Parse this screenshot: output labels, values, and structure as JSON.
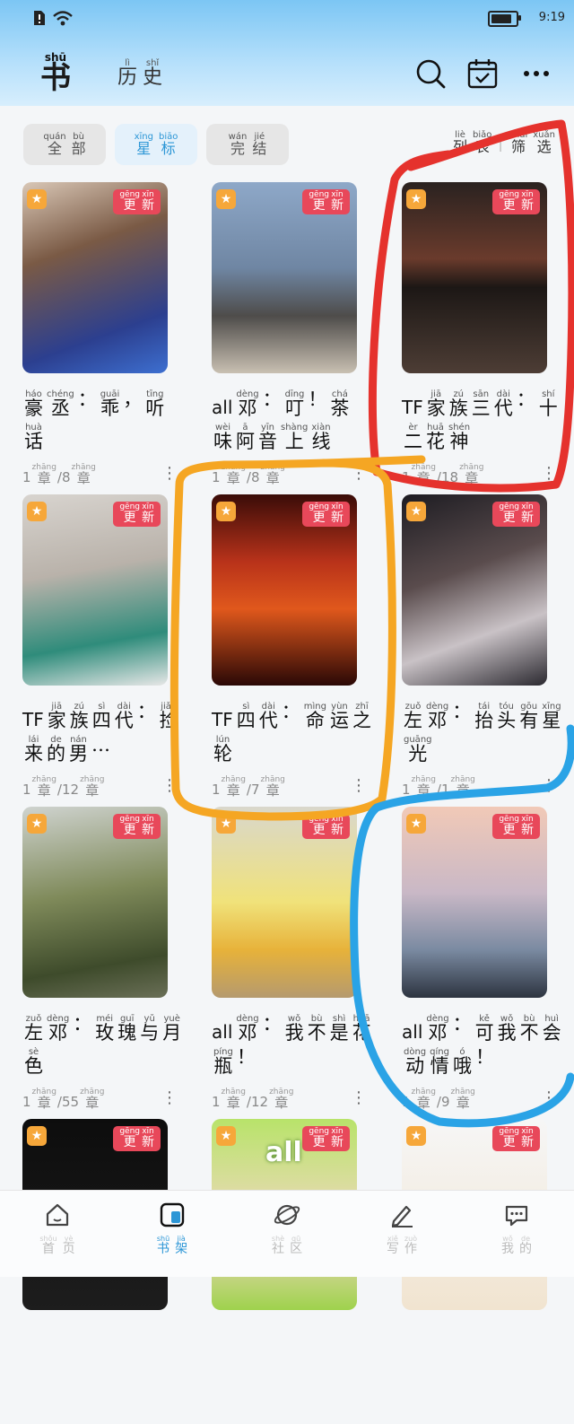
{
  "status": {
    "time": "9:19"
  },
  "header": {
    "logo": {
      "py": "shū",
      "hz": "书"
    },
    "tab_history": [
      {
        "py": "lì",
        "hz": "历"
      },
      {
        "py": "shǐ",
        "hz": "史"
      }
    ],
    "icons": [
      "search-icon",
      "calendar-check-icon",
      "more-icon"
    ]
  },
  "filters": {
    "chips": [
      {
        "chars": [
          {
            "py": "quán",
            "hz": "全"
          },
          {
            "py": "bù",
            "hz": "部"
          }
        ],
        "active": false
      },
      {
        "chars": [
          {
            "py": "xīng",
            "hz": "星"
          },
          {
            "py": "biāo",
            "hz": "标"
          }
        ],
        "active": true
      },
      {
        "chars": [
          {
            "py": "wán",
            "hz": "完"
          },
          {
            "py": "jié",
            "hz": "结"
          }
        ],
        "active": false
      }
    ],
    "list_label": [
      {
        "py": "liè",
        "hz": "列"
      },
      {
        "py": "biǎo",
        "hz": "表"
      }
    ],
    "filter_label": [
      {
        "py": "shāi",
        "hz": "筛"
      },
      {
        "py": "xuǎn",
        "hz": "选"
      }
    ]
  },
  "badge": [
    {
      "py": "gēng",
      "hz": "更"
    },
    {
      "py": "xīn",
      "hz": "新"
    }
  ],
  "books": [
    {
      "prefix": "",
      "title": [
        {
          "py": "háo",
          "hz": "豪"
        },
        {
          "py": "chéng",
          "hz": "丞"
        },
        {
          "py": "",
          "hz": "："
        },
        {
          "py": "guāi",
          "hz": "乖"
        },
        {
          "py": "",
          "hz": "，"
        },
        {
          "py": "tīng",
          "hz": "听"
        },
        {
          "py": "huà",
          "hz": "话"
        }
      ],
      "read": "1",
      "total": "8"
    },
    {
      "prefix": "all",
      "title": [
        {
          "py": "dèng",
          "hz": "邓"
        },
        {
          "py": "",
          "hz": "："
        },
        {
          "py": "dīng",
          "hz": "叮"
        },
        {
          "py": "",
          "hz": "！"
        },
        {
          "py": "chá",
          "hz": "茶"
        },
        {
          "py": "wèi",
          "hz": "味"
        },
        {
          "py": "ā",
          "hz": "阿"
        },
        {
          "py": "yīn",
          "hz": "音"
        },
        {
          "py": "shàng",
          "hz": "上"
        },
        {
          "py": "xiàn",
          "hz": "线"
        }
      ],
      "read": "1",
      "total": "8"
    },
    {
      "prefix": "TF",
      "title": [
        {
          "py": "jiā",
          "hz": "家"
        },
        {
          "py": "zú",
          "hz": "族"
        },
        {
          "py": "sān",
          "hz": "三"
        },
        {
          "py": "dài",
          "hz": "代"
        },
        {
          "py": "",
          "hz": "："
        },
        {
          "py": "shí",
          "hz": "十"
        },
        {
          "py": "èr",
          "hz": "二"
        },
        {
          "py": "huā",
          "hz": "花"
        },
        {
          "py": "shén",
          "hz": "神"
        }
      ],
      "read": "1",
      "total": "18"
    },
    {
      "prefix": "TF",
      "title": [
        {
          "py": "jiā",
          "hz": "家"
        },
        {
          "py": "zú",
          "hz": "族"
        },
        {
          "py": "sì",
          "hz": "四"
        },
        {
          "py": "dài",
          "hz": "代"
        },
        {
          "py": "",
          "hz": "："
        },
        {
          "py": "jiǎn",
          "hz": "捡"
        },
        {
          "py": "lái",
          "hz": "来"
        },
        {
          "py": "de",
          "hz": "的"
        },
        {
          "py": "nán",
          "hz": "男"
        },
        {
          "py": "",
          "hz": "…"
        }
      ],
      "read": "1",
      "total": "12"
    },
    {
      "prefix": "TF",
      "title": [
        {
          "py": "sì",
          "hz": "四"
        },
        {
          "py": "dài",
          "hz": "代"
        },
        {
          "py": "",
          "hz": "："
        },
        {
          "py": "mìng",
          "hz": "命"
        },
        {
          "py": "yùn",
          "hz": "运"
        },
        {
          "py": "zhī",
          "hz": "之"
        },
        {
          "py": "lún",
          "hz": "轮"
        }
      ],
      "read": "1",
      "total": "7"
    },
    {
      "prefix": "",
      "title": [
        {
          "py": "zuǒ",
          "hz": "左"
        },
        {
          "py": "dèng",
          "hz": "邓"
        },
        {
          "py": "",
          "hz": "："
        },
        {
          "py": "tái",
          "hz": "抬"
        },
        {
          "py": "tóu",
          "hz": "头"
        },
        {
          "py": "gōu",
          "hz": "有"
        },
        {
          "py": "xīng",
          "hz": "星"
        },
        {
          "py": "guāng",
          "hz": "光"
        }
      ],
      "read": "1",
      "total": "1"
    },
    {
      "prefix": "",
      "title": [
        {
          "py": "zuǒ",
          "hz": "左"
        },
        {
          "py": "dèng",
          "hz": "邓"
        },
        {
          "py": "",
          "hz": "："
        },
        {
          "py": "méi",
          "hz": "玫"
        },
        {
          "py": "guī",
          "hz": "瑰"
        },
        {
          "py": "yǔ",
          "hz": "与"
        },
        {
          "py": "yuè",
          "hz": "月"
        },
        {
          "py": "sè",
          "hz": "色"
        }
      ],
      "read": "1",
      "total": "55"
    },
    {
      "prefix": "all",
      "title": [
        {
          "py": "dèng",
          "hz": "邓"
        },
        {
          "py": "",
          "hz": "："
        },
        {
          "py": "wǒ",
          "hz": "我"
        },
        {
          "py": "bù",
          "hz": "不"
        },
        {
          "py": "shì",
          "hz": "是"
        },
        {
          "py": "huā",
          "hz": "花"
        },
        {
          "py": "píng",
          "hz": "瓶"
        },
        {
          "py": "",
          "hz": "！"
        }
      ],
      "read": "1",
      "total": "12"
    },
    {
      "prefix": "all",
      "title": [
        {
          "py": "dèng",
          "hz": "邓"
        },
        {
          "py": "",
          "hz": "："
        },
        {
          "py": "kě",
          "hz": "可"
        },
        {
          "py": "wǒ",
          "hz": "我"
        },
        {
          "py": "bù",
          "hz": "不"
        },
        {
          "py": "huì",
          "hz": "会"
        },
        {
          "py": "dòng",
          "hz": "动"
        },
        {
          "py": "qíng",
          "hz": "情"
        },
        {
          "py": "ó",
          "hz": "哦"
        },
        {
          "py": "",
          "hz": "！"
        }
      ],
      "read": "1",
      "total": "9"
    },
    {
      "prefix": "",
      "title": [],
      "read": "",
      "total": ""
    },
    {
      "prefix": "",
      "title": [],
      "read": "",
      "total": "",
      "cover_text": "all"
    },
    {
      "prefix": "",
      "title": [],
      "read": "",
      "total": ""
    }
  ],
  "chapter_unit": {
    "py": "zhāng",
    "hz": "章"
  },
  "nav": [
    {
      "chars": [
        {
          "py": "shǒu",
          "hz": "首"
        },
        {
          "py": "yè",
          "hz": "页"
        }
      ],
      "icon": "home-icon"
    },
    {
      "chars": [
        {
          "py": "shū",
          "hz": "书"
        },
        {
          "py": "jià",
          "hz": "架"
        }
      ],
      "icon": "bookshelf-icon",
      "active": true
    },
    {
      "chars": [
        {
          "py": "shè",
          "hz": "社"
        },
        {
          "py": "qū",
          "hz": "区"
        }
      ],
      "icon": "planet-icon"
    },
    {
      "chars": [
        {
          "py": "xiě",
          "hz": "写"
        },
        {
          "py": "zuò",
          "hz": "作"
        }
      ],
      "icon": "pen-icon"
    },
    {
      "chars": [
        {
          "py": "wǒ",
          "hz": "我"
        },
        {
          "py": "de",
          "hz": "的"
        }
      ],
      "icon": "message-icon"
    }
  ],
  "colors": {
    "accent": "#2c96d6",
    "badge": "#e8485a",
    "star": "#f6a73a",
    "annotation_red": "#e5322d",
    "annotation_orange": "#f5a623",
    "annotation_blue": "#2aa3e6"
  }
}
